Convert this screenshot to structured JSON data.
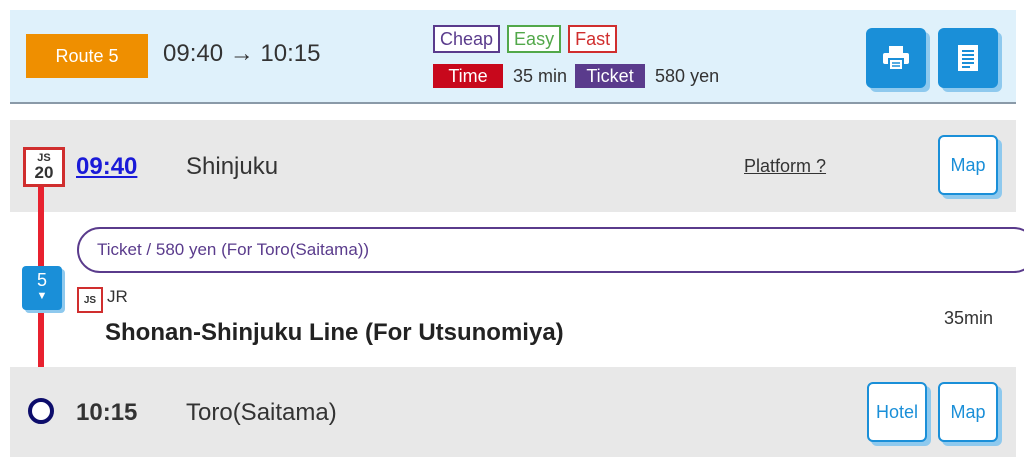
{
  "header": {
    "route_label": "Route 5",
    "route_time": "09:40 → 10:15",
    "tags": {
      "cheap": "Cheap",
      "easy": "Easy",
      "fast": "Fast"
    },
    "time_label": "Time",
    "time_value": "35 min",
    "ticket_label": "Ticket",
    "ticket_value": "580 yen",
    "buttons": {
      "print_icon": "printer-icon",
      "memo_icon": "document-icon"
    }
  },
  "departure": {
    "code_line": "JS",
    "code_number": "20",
    "time": "09:40",
    "station": "Shinjuku",
    "platform": "Platform ?",
    "map_label": "Map"
  },
  "segment": {
    "stops": "5",
    "stops_arrow": "▼",
    "ticket": "Ticket / 580 yen (For Toro(Saitama))",
    "line_code": "JS",
    "company": "JR",
    "line_name": "Shonan-Shinjuku Line (For Utsunomiya)",
    "duration": "35min"
  },
  "arrival": {
    "time": "10:15",
    "station": "Toro(Saitama)",
    "hotel_label": "Hotel",
    "map_label": "Map"
  },
  "colors": {
    "route_badge": "#ef8f00",
    "primary_blue": "#1a8fd8",
    "line_red": "#e8212f",
    "ticket_purple": "#5a3b8c",
    "time_red": "#c8081c"
  }
}
